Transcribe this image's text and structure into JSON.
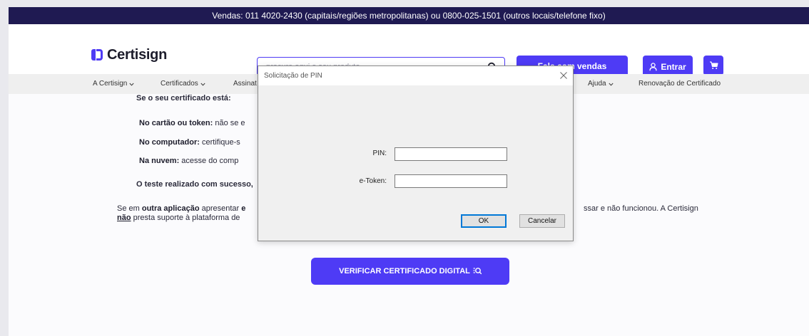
{
  "topbar": {
    "text": "Vendas: 011 4020-2430 (capitais/regiões metropolitanas) ou 0800-025-1501 (outros locais/telefone fixo)"
  },
  "header": {
    "logo": "Certisign",
    "search_placeholder": "procure aqui o seu produto",
    "search_value": "",
    "sales_button": "Fale com vendas",
    "login_button": "Entrar"
  },
  "nav": {
    "items": [
      "A Certisign",
      "Certificados",
      "Assinat",
      "Ajuda",
      "Renovação de Certificado"
    ]
  },
  "content": {
    "heading": "Se o seu certificado está:",
    "card_bold": "No cartão ou token:",
    "card_rest": " não se e",
    "computer_bold": "No computador:",
    "computer_rest": " certifique-s",
    "cloud_bold": "Na nuvem:",
    "cloud_rest": " acesse do comp",
    "success_line": "O teste realizado com sucesso,",
    "other_p1": "Se em ",
    "other_bold": "outra aplicação",
    "other_p2": " apresentar ",
    "other_bold2": "e",
    "other_right": "ssar e não funcionou. A Certisign",
    "nao_bold": "não",
    "nao_rest": " presta suporte à plataforma de",
    "verify_button": "VERIFICAR CERTIFICADO DIGITAL"
  },
  "dialog": {
    "title": "Solicitação de PIN",
    "pin_label": "PIN:",
    "pin_value": "",
    "etoken_label": "e-Token:",
    "etoken_value": "",
    "ok_button": "OK",
    "cancel_button": "Cancelar"
  },
  "colors": {
    "brand": "#4e3bf5",
    "topbar": "#1f1a52"
  }
}
